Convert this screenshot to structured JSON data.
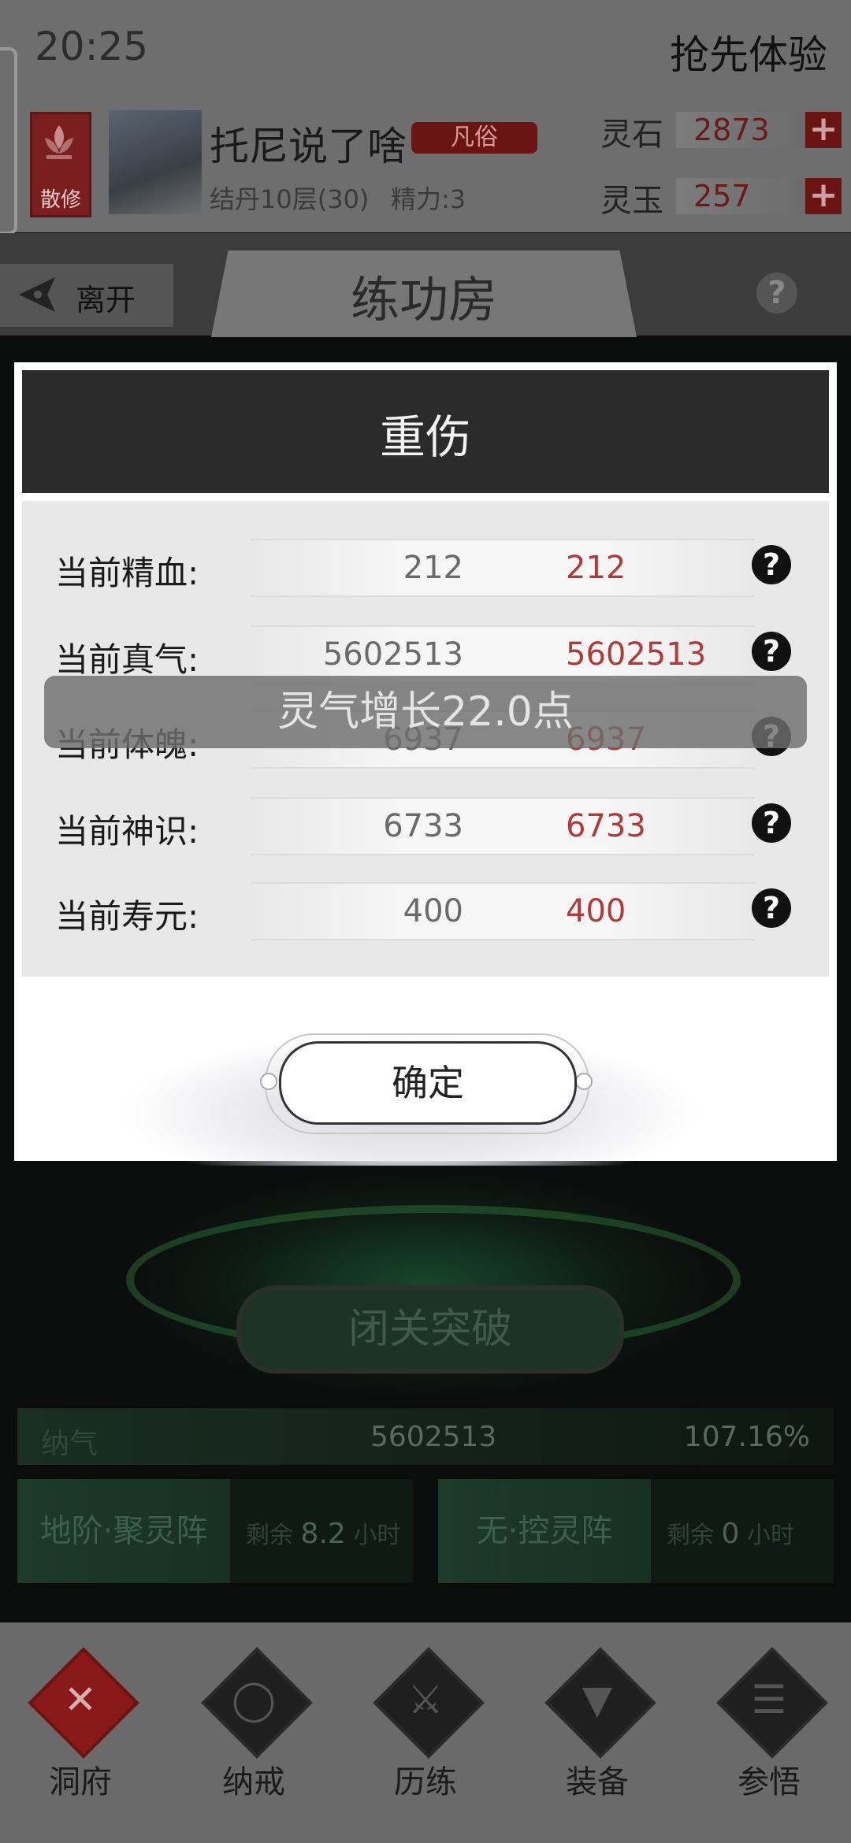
{
  "status": {
    "time": "20:25",
    "early_access": "抢先体验"
  },
  "profile": {
    "sect": "散修",
    "name": "托尼说了啥",
    "rank": "凡俗",
    "level": "结丹10层(30)",
    "energy": "精力:3",
    "currencies": [
      {
        "label": "灵石",
        "value": "2873"
      },
      {
        "label": "灵玉",
        "value": "257"
      }
    ]
  },
  "nav": {
    "leave": "离开",
    "title": "练功房",
    "help": "?"
  },
  "modal": {
    "title": "重伤",
    "rows": [
      {
        "label": "当前精血:",
        "old": "212",
        "new": "212"
      },
      {
        "label": "当前真气:",
        "old": "5602513",
        "new": "5602513"
      },
      {
        "label": "当前体魄:",
        "old": "6937",
        "new": "6937"
      },
      {
        "label": "当前神识:",
        "old": "6733",
        "new": "6733"
      },
      {
        "label": "当前寿元:",
        "old": "400",
        "new": "400"
      }
    ],
    "help_glyph": "?",
    "confirm": "确定"
  },
  "toast": "灵气增长22.0点",
  "cultivation": {
    "breakthrough": "闭关突破",
    "qi_label": "纳气",
    "qi_value": "5602513",
    "qi_percent": "107.16%",
    "arrays": [
      {
        "name": "地阶·聚灵阵",
        "remaining_prefix": "剩余",
        "remaining_value": "8.2",
        "remaining_unit": "小时"
      },
      {
        "name": "无·控灵阵",
        "remaining_prefix": "剩余",
        "remaining_value": "0",
        "remaining_unit": "小时"
      }
    ]
  },
  "tabs": [
    {
      "label": "洞府",
      "icon": "cross-icon",
      "active": true
    },
    {
      "label": "纳戒",
      "icon": "ring-icon",
      "active": false
    },
    {
      "label": "历练",
      "icon": "swords-icon",
      "active": false
    },
    {
      "label": "装备",
      "icon": "sword-icon",
      "active": false
    },
    {
      "label": "参悟",
      "icon": "book-icon",
      "active": false
    }
  ],
  "colors": {
    "accent_red": "#b03a3a",
    "modal_header": "#2b2b2b",
    "jade_green": "#1e3a29"
  }
}
